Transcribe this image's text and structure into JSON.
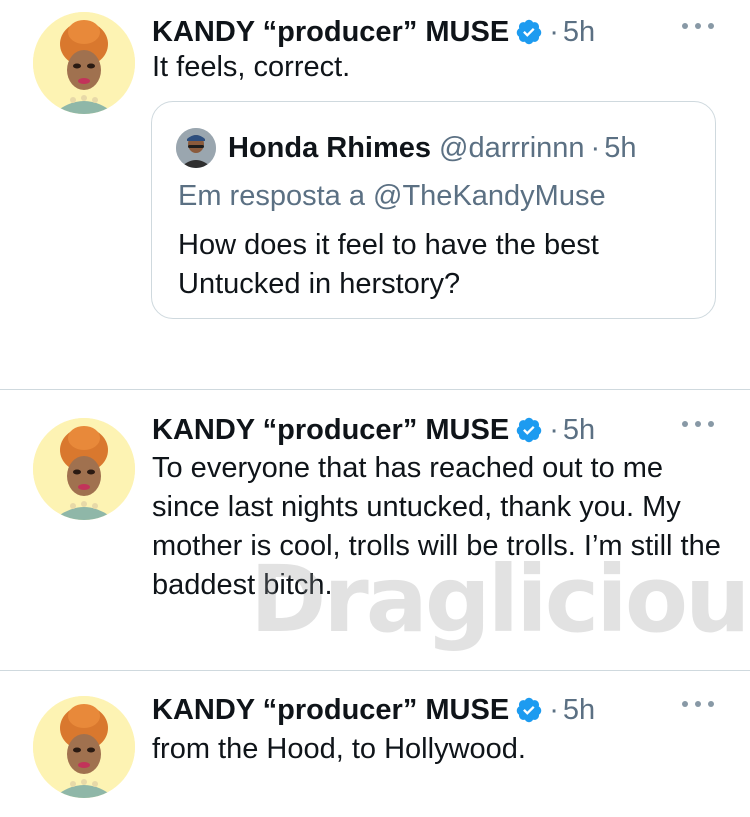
{
  "tweets": [
    {
      "author_name": "KANDY “producer” MUSE",
      "separator": "·",
      "time": "5h",
      "text": "It feels, correct.",
      "quoted": {
        "author_name": "Honda Rhimes",
        "handle": "@darrrinnn",
        "separator": "·",
        "time": "5h",
        "reply_context": "Em resposta a @TheKandyMuse",
        "text": "How does it feel to have the best Untucked in herstory?"
      }
    },
    {
      "author_name": "KANDY “producer” MUSE",
      "separator": "·",
      "time": "5h",
      "text": "To everyone that has reached out to me since last nights untucked, thank you. My mother is cool, trolls will be trolls. I’m still the baddest bitch."
    },
    {
      "author_name": "KANDY “producer” MUSE",
      "separator": "·",
      "time": "5h",
      "text": "from the Hood, to Hollywood."
    }
  ],
  "watermark": "Draglicious",
  "icons": {
    "verified": "verified-badge-icon",
    "more": "more-options-icon"
  },
  "colors": {
    "verified_blue": "#1d9bf0",
    "secondary_text": "#5b7083",
    "divider": "#cfd9de",
    "avatar_background": "#fdf3b3"
  }
}
